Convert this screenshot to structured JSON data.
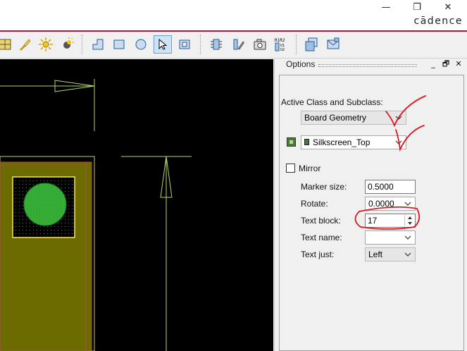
{
  "window": {
    "minimize_glyph": "—",
    "restore_glyph": "❐",
    "close_glyph": "✕",
    "brand": "cādence"
  },
  "toolbar": {
    "icons": [
      "grid-text-icon",
      "paint-brush-icon",
      "sun-icon",
      "dark-sun-icon",
      "l-shape-icon",
      "rectangle-icon",
      "circle-icon",
      "select-arrow-icon",
      "frame-shape-icon",
      "component-icon",
      "pin-edit-icon",
      "camera-icon",
      "label-tune-icon",
      "copy-windows-icon",
      "envelope-icon"
    ],
    "pressed": "select-arrow-icon"
  },
  "options_panel": {
    "title": "Options",
    "header_controls": [
      "_",
      "🗗",
      "✕"
    ],
    "active_class_label": "Active Class and Subclass:",
    "class_value": "Board Geometry",
    "subclass_value": "Silkscreen_Top",
    "subclass_color": "#4c7a3a",
    "mirror_label": "Mirror",
    "mirror_checked": false,
    "fields": {
      "marker_size": {
        "label": "Marker size:",
        "value": "0.5000"
      },
      "rotate": {
        "label": "Rotate:",
        "value": "0.0000"
      },
      "text_block": {
        "label": "Text block:",
        "value": "17"
      },
      "text_name": {
        "label": "Text name:",
        "value": ""
      },
      "text_just": {
        "label": "Text just:",
        "value": "Left"
      }
    }
  },
  "colors": {
    "canvas_bg": "#000000",
    "board_fill": "#6b6b00",
    "pad_fill": "#33aa33",
    "outline": "#b5d36b",
    "annotation_red": "#e0141e"
  }
}
